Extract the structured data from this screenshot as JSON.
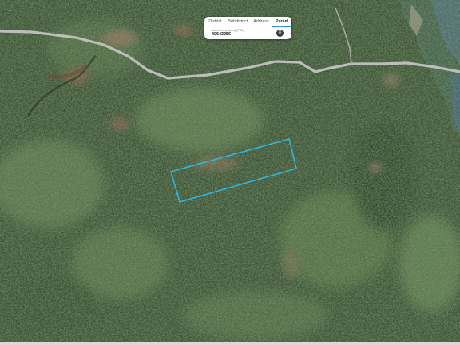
{
  "search": {
    "tabs": [
      {
        "label": "District",
        "active": false
      },
      {
        "label": "Subdistrict",
        "active": false
      },
      {
        "label": "Address",
        "active": false
      },
      {
        "label": "Parcel",
        "active": true
      }
    ],
    "hint": "Search by property (PID)",
    "value": "40643256",
    "clear_icon": "close-icon"
  },
  "colors": {
    "forest_dark": "#2c4127",
    "forest_mid": "#3f5a35",
    "clearing": "#6f8a53",
    "wetland": "#7a5a40",
    "water": "#3d6378",
    "road": "#c9c9c6",
    "parcel_outline": "#2fb7e0",
    "tab_active_underline": "#2f8fd8"
  }
}
